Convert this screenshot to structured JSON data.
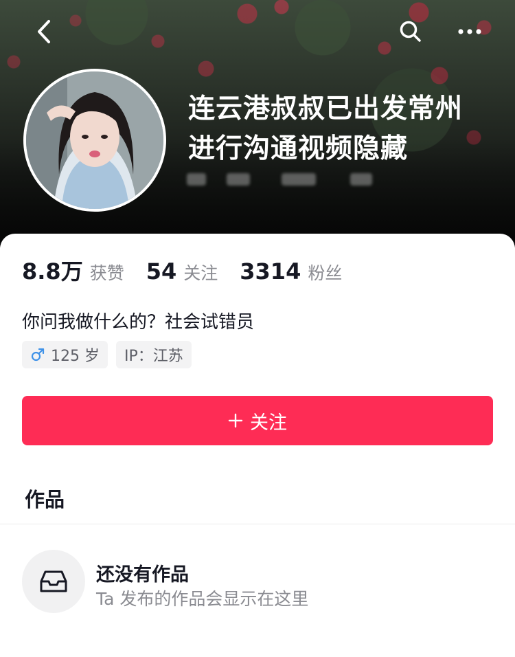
{
  "header": {
    "title": "连云港叔叔已出发常州\n进行沟通视频隐藏",
    "icons": [
      "back-icon",
      "search-icon",
      "more-icon"
    ]
  },
  "stats": [
    {
      "value": "8.8万",
      "label": "获赞"
    },
    {
      "value": "54",
      "label": "关注"
    },
    {
      "value": "3314",
      "label": "粉丝"
    }
  ],
  "bio": "你问我做什么的？社会试错员",
  "tags": {
    "age": "125 岁",
    "ip": "IP：江苏"
  },
  "follow_button": "关注",
  "works": {
    "tab_label": "作品",
    "empty_title": "还没有作品",
    "empty_subtitle": "Ta 发布的作品会显示在这里"
  },
  "colors": {
    "accent": "#fe2c55",
    "male": "#3f92e8",
    "muted_text": "#8a8b91"
  }
}
